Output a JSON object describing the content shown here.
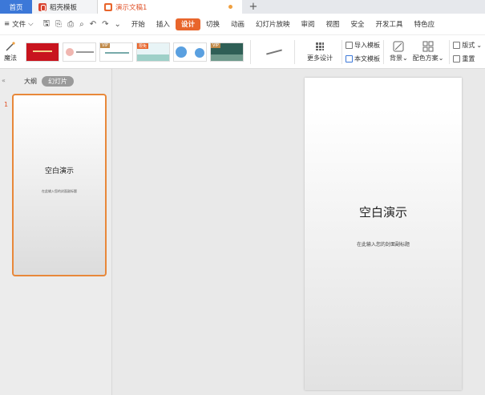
{
  "tabs": {
    "home": "首页",
    "daoke": "稻壳模板",
    "document": "演示文稿1",
    "add": "+"
  },
  "menu": {
    "file": "文件",
    "items": [
      "开始",
      "插入",
      "设计",
      "切换",
      "动画",
      "幻灯片放映",
      "审阅",
      "视图",
      "安全",
      "开发工具",
      "特色应"
    ],
    "active_index": 2
  },
  "ribbon": {
    "magic": "魔法",
    "more_design": "更多设计",
    "import_template": "导入模板",
    "this_template": "本文模板",
    "background": "背景",
    "color_scheme": "配色方案",
    "layout": "版式",
    "reset": "重置",
    "badges": {
      "vip": "VIP",
      "free": "限免"
    }
  },
  "panel": {
    "tab_outline": "大纲",
    "tab_slides": "幻灯片",
    "slide_number": "1"
  },
  "slide": {
    "title": "空白演示",
    "subtitle": "在此输入您的封面副标题"
  },
  "colors": {
    "accent": "#e8652b",
    "home_tab": "#3c78d8",
    "selection": "#e8883a"
  }
}
